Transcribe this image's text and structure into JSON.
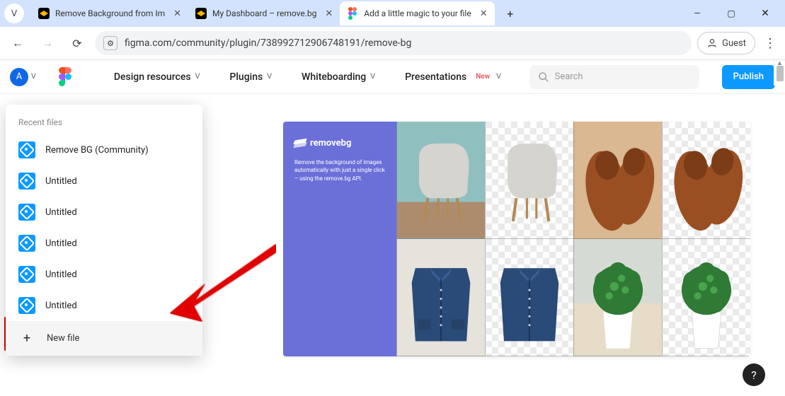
{
  "browser": {
    "tabs": [
      {
        "title": "Remove Background from Im",
        "active": false
      },
      {
        "title": "My Dashboard – remove.bg",
        "active": false
      },
      {
        "title": "Add a little magic to your file",
        "active": true
      }
    ],
    "url": "figma.com/community/plugin/738992712906748191/remove-bg",
    "profile_label": "Guest",
    "window_controls": {
      "min": "—",
      "max": "▢",
      "close": "✕"
    }
  },
  "figma": {
    "avatar_letter": "A",
    "nav": {
      "design_resources": "Design resources",
      "plugins": "Plugins",
      "whiteboarding": "Whiteboarding",
      "presentations": "Presentations",
      "new_badge": "New"
    },
    "search_placeholder": "Search",
    "publish_label": "Publish"
  },
  "dropdown": {
    "section": "Recent files",
    "files": [
      {
        "name": "Remove BG (Community)"
      },
      {
        "name": "Untitled"
      },
      {
        "name": "Untitled"
      },
      {
        "name": "Untitled"
      },
      {
        "name": "Untitled"
      },
      {
        "name": "Untitled"
      }
    ],
    "new_file": "New file"
  },
  "hero": {
    "brand": "removebg",
    "tagline": "Remove the background of images automatically with just a single click – using the remove.bg API."
  },
  "help": "?"
}
